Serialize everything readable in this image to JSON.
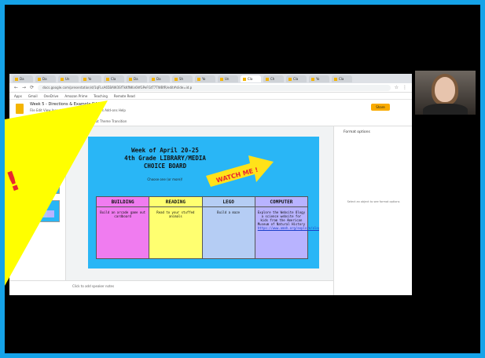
{
  "browser": {
    "tabs": [
      "Da",
      "Da",
      "Un",
      "Yo",
      "Cla",
      "Da",
      "Da",
      "Sh",
      "Yo",
      "Un",
      "Cla",
      "Ch",
      "Cla",
      "Yo",
      "Cla"
    ],
    "url": "docs.google.com/presentation/d/1qFLsA65BAW3SfTkKfNKn6hfGPeFGtT7TWBfR/edit#slide=id.p",
    "bookmarks": [
      "Apps",
      "Gmail",
      "OneDrive",
      "Amazon Prime",
      "Teaching",
      "Remote Read"
    ]
  },
  "slides_app": {
    "doc_title": "Week 5 - Directions & Example DAS",
    "menu": "File  Edit  View  Insert  Format  Slide  Arrange  Tools  Add-ons  Help",
    "share_label": "Share",
    "toolbar": "Background   Layout   Theme   Transition",
    "speaker_notes": "Click to add speaker notes",
    "panel_title": "Format options",
    "panel_message": "Select an object to see format options"
  },
  "slide": {
    "title_lines": [
      "Week of April 20-25",
      "4th Grade LIBRARY/MEDIA",
      "CHOICE BOARD"
    ],
    "subtitle": "Choose one (or more)!",
    "watch_label": "WATCH ME !",
    "columns": [
      {
        "header": "BUILDING",
        "body": "Build an arcade game out cardboard",
        "link": ""
      },
      {
        "header": "READING",
        "body": "Read to your stuffed animals",
        "link": ""
      },
      {
        "header": "LEGO",
        "body": "Build a maze",
        "link": ""
      },
      {
        "header": "COMPUTER",
        "body": "Explore the Website Ology a science website for kids from the American Museum of Natural History",
        "link": "https://www.amnh.org/explore/ology"
      }
    ]
  },
  "overlay": {
    "mark": "!"
  },
  "colors": {
    "frame": "#15a3e8",
    "slide_bg": "#29b6f6",
    "overlay_yellow": "#ffff00",
    "watch_red": "#e8262e"
  }
}
